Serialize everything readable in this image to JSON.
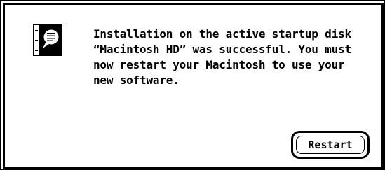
{
  "dialog": {
    "icon": "installer-note-icon",
    "message": "Installation on the active startup disk\n“Macintosh HD” was successful.  You must\nnow restart your Macintosh to use your\nnew software.",
    "default_button_label": "Restart"
  },
  "colors": {
    "foreground": "#000000",
    "background": "#ffffff"
  }
}
